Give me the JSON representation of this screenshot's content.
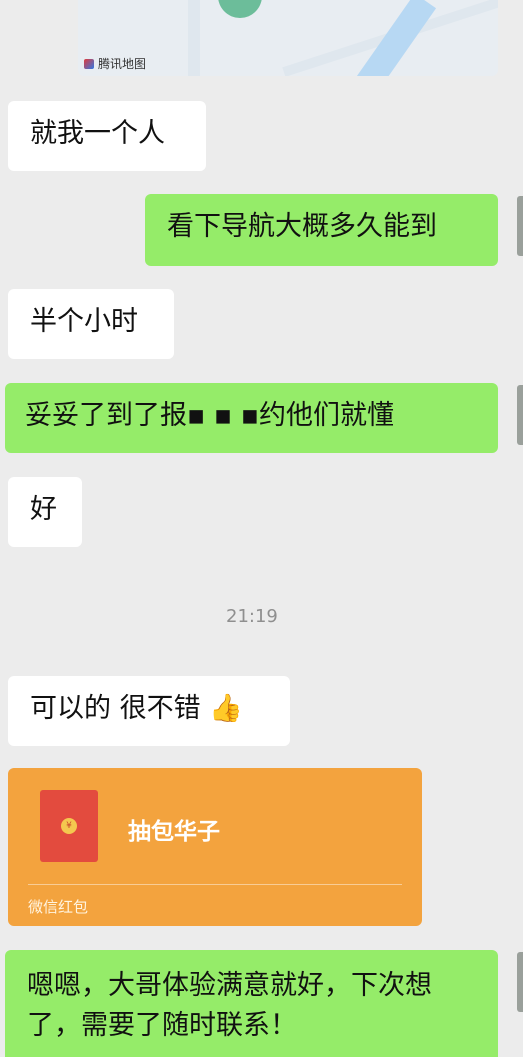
{
  "map_card": {
    "provider_label": "腾讯地图"
  },
  "messages": [
    {
      "side": "left",
      "text": "就我一个人"
    },
    {
      "side": "right",
      "text": "看下导航大概多久能到"
    },
    {
      "side": "left",
      "text": "半个小时"
    },
    {
      "side": "right",
      "text": "妥妥了到了报▪ ▪ ▪约他们就懂"
    },
    {
      "side": "left",
      "text": "好"
    },
    {
      "side": "left",
      "text": "可以的 很不错 👍"
    },
    {
      "side": "right",
      "line1": "嗯嗯，大哥体验满意就好，下次想",
      "line2": "了，需要了随时联系！"
    }
  ],
  "timestamp": "21:19",
  "red_envelope": {
    "title": "抽包华子",
    "footer": "微信红包",
    "coin_symbol": "¥"
  },
  "colors": {
    "background": "#ececec",
    "left_bubble": "#ffffff",
    "right_bubble": "#95ec69",
    "envelope": "#f3a33e"
  }
}
